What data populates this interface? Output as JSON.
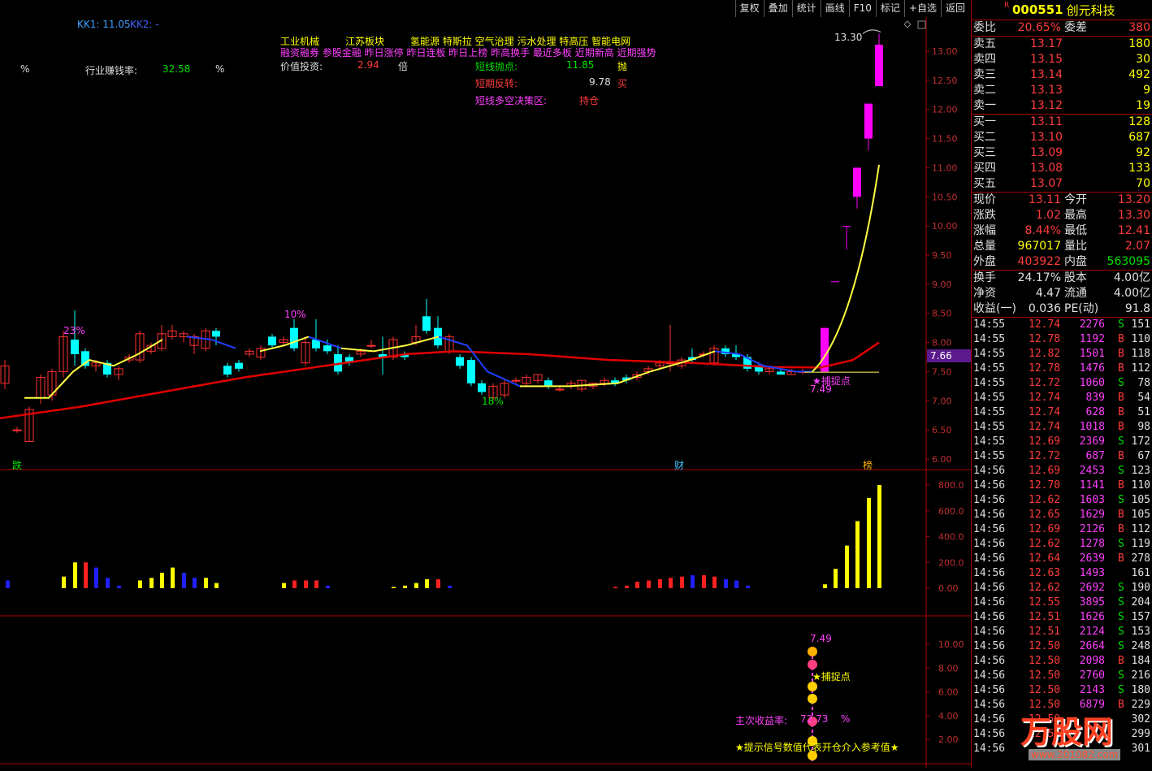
{
  "toolbar": [
    "复权",
    "叠加",
    "统计",
    "画线",
    "F10",
    "标记",
    "+自选",
    "返回"
  ],
  "header_left": {
    "kk1": "KK1: 11.05",
    "kk2": "KK2: -"
  },
  "sectors": {
    "line1_a": "工业机械",
    "line1_b": "江苏板块",
    "line1_c": "氢能源 特斯拉 空气治理 污水处理 特高压 智能电网",
    "line2": "融资融券 参股金融 昨日涨停 昨日连板 昨日上榜 昨高换手 最近多板 近期新高 近期强势"
  },
  "info": {
    "pct": "%",
    "industry_label": "行业赚钱率:",
    "industry_value": "32.58",
    "industry_unit": "%",
    "value_label": "价值投资:",
    "value_value": "2.94",
    "value_unit": "倍",
    "short_sell_label": "短线抛点:",
    "short_sell_value": "11.85",
    "short_sell_tag": "抛",
    "short_rev_label": "短期反转:",
    "short_rev_value": "9.78",
    "short_rev_tag": "买",
    "decision_label": "短线多空决策区:",
    "decision_value": "持仓"
  },
  "price_axis": [
    "13.00",
    "12.50",
    "12.00",
    "11.50",
    "11.00",
    "10.50",
    "10.00",
    "9.50",
    "9.00",
    "8.50",
    "8.00",
    "7.50",
    "7.00",
    "6.50",
    "6.00"
  ],
  "price_marker": "7.66",
  "annotations": {
    "high": "13.30",
    "pct23": "23%",
    "pct10": "10%",
    "pct18": "18%",
    "low": "7.49",
    "capture": "★捕捉点",
    "die": "跌",
    "cai": "财",
    "bang": "榜"
  },
  "vol_axis": [
    "800.0",
    "600.0",
    "400.0",
    "200.0",
    "0.00"
  ],
  "ind_axis": [
    "10.00",
    "8.00",
    "6.00",
    "4.00",
    "2.00"
  ],
  "ind": {
    "top": "7.49",
    "capture": "★捕捉点",
    "profit_label": "主次收益率:",
    "profit_value": "72.73",
    "profit_unit": "%",
    "hint": "★提示信号数值代表开仓介入参考值★"
  },
  "watermark": {
    "name": "万股网",
    "url": "www.201082.com"
  },
  "stock": {
    "flag": "R",
    "code": "000551",
    "name": "创元科技"
  },
  "weibi": {
    "l1": "委比",
    "v1": "20.65%",
    "l2": "委差",
    "v2": "380"
  },
  "asks": [
    {
      "label": "卖五",
      "price": "13.17",
      "vol": "180"
    },
    {
      "label": "卖四",
      "price": "13.15",
      "vol": "30"
    },
    {
      "label": "卖三",
      "price": "13.14",
      "vol": "492"
    },
    {
      "label": "卖二",
      "price": "13.13",
      "vol": "9"
    },
    {
      "label": "卖一",
      "price": "13.12",
      "vol": "19"
    }
  ],
  "bids": [
    {
      "label": "买一",
      "price": "13.11",
      "vol": "128"
    },
    {
      "label": "买二",
      "price": "13.10",
      "vol": "687"
    },
    {
      "label": "买三",
      "price": "13.09",
      "vol": "92"
    },
    {
      "label": "买四",
      "price": "13.08",
      "vol": "133"
    },
    {
      "label": "买五",
      "price": "13.07",
      "vol": "70"
    }
  ],
  "quote": [
    {
      "l1": "现价",
      "v1": "13.11",
      "c1": "red",
      "l2": "今开",
      "v2": "13.20",
      "c2": "red"
    },
    {
      "l1": "涨跌",
      "v1": "1.02",
      "c1": "red",
      "l2": "最高",
      "v2": "13.30",
      "c2": "red"
    },
    {
      "l1": "涨幅",
      "v1": "8.44%",
      "c1": "red",
      "l2": "最低",
      "v2": "12.41",
      "c2": "red"
    },
    {
      "l1": "总量",
      "v1": "967017",
      "c1": "yel",
      "l2": "量比",
      "v2": "2.07",
      "c2": "red"
    },
    {
      "l1": "外盘",
      "v1": "403922",
      "c1": "red",
      "l2": "内盘",
      "v2": "563095",
      "c2": "grn"
    }
  ],
  "fund": [
    {
      "l1": "换手",
      "v1": "24.17%",
      "l2": "股本",
      "v2": "4.00亿"
    },
    {
      "l1": "净资",
      "v1": "4.47",
      "l2": "流通",
      "v2": "4.00亿"
    },
    {
      "l1": "收益(一)",
      "v1": "0.036",
      "l2": "PE(动)",
      "v2": "91.8"
    }
  ],
  "ticks": [
    {
      "t": "14:55",
      "p": "12.74",
      "v": "2276",
      "s": "S",
      "n": "151"
    },
    {
      "t": "14:55",
      "p": "12.78",
      "v": "1192",
      "s": "B",
      "n": "110"
    },
    {
      "t": "14:55",
      "p": "12.82",
      "v": "1501",
      "s": "B",
      "n": "118"
    },
    {
      "t": "14:55",
      "p": "12.78",
      "v": "1476",
      "s": "B",
      "n": "112"
    },
    {
      "t": "14:55",
      "p": "12.72",
      "v": "1060",
      "s": "S",
      "n": "78"
    },
    {
      "t": "14:55",
      "p": "12.74",
      "v": "839",
      "s": "B",
      "n": "54"
    },
    {
      "t": "14:55",
      "p": "12.74",
      "v": "628",
      "s": "B",
      "n": "51"
    },
    {
      "t": "14:55",
      "p": "12.74",
      "v": "1018",
      "s": "B",
      "n": "98"
    },
    {
      "t": "14:55",
      "p": "12.69",
      "v": "2369",
      "s": "S",
      "n": "172"
    },
    {
      "t": "14:55",
      "p": "12.72",
      "v": "687",
      "s": "B",
      "n": "67"
    },
    {
      "t": "14:56",
      "p": "12.69",
      "v": "2453",
      "s": "S",
      "n": "123"
    },
    {
      "t": "14:56",
      "p": "12.70",
      "v": "1141",
      "s": "B",
      "n": "110"
    },
    {
      "t": "14:56",
      "p": "12.62",
      "v": "1603",
      "s": "S",
      "n": "105"
    },
    {
      "t": "14:56",
      "p": "12.65",
      "v": "1629",
      "s": "B",
      "n": "105"
    },
    {
      "t": "14:56",
      "p": "12.69",
      "v": "2126",
      "s": "B",
      "n": "112"
    },
    {
      "t": "14:56",
      "p": "12.62",
      "v": "1278",
      "s": "S",
      "n": "119"
    },
    {
      "t": "14:56",
      "p": "12.64",
      "v": "2639",
      "s": "B",
      "n": "278"
    },
    {
      "t": "14:56",
      "p": "12.63",
      "v": "1493",
      "s": "",
      "n": "161"
    },
    {
      "t": "14:56",
      "p": "12.62",
      "v": "2692",
      "s": "S",
      "n": "190"
    },
    {
      "t": "14:56",
      "p": "12.55",
      "v": "3895",
      "s": "S",
      "n": "204"
    },
    {
      "t": "14:56",
      "p": "12.51",
      "v": "1626",
      "s": "S",
      "n": "157"
    },
    {
      "t": "14:56",
      "p": "12.51",
      "v": "2124",
      "s": "S",
      "n": "153"
    },
    {
      "t": "14:56",
      "p": "12.50",
      "v": "2664",
      "s": "S",
      "n": "248"
    },
    {
      "t": "14:56",
      "p": "12.50",
      "v": "2098",
      "s": "B",
      "n": "184"
    },
    {
      "t": "14:56",
      "p": "12.50",
      "v": "2760",
      "s": "S",
      "n": "216"
    },
    {
      "t": "14:56",
      "p": "12.50",
      "v": "2143",
      "s": "S",
      "n": "180"
    },
    {
      "t": "14:56",
      "p": "12.50",
      "v": "6879",
      "s": "B",
      "n": "229"
    },
    {
      "t": "14:56",
      "p": "12.50",
      "v": "",
      "s": "",
      "n": "302"
    },
    {
      "t": "14:56",
      "p": "12.50",
      "v": "",
      "s": "",
      "n": "299"
    },
    {
      "t": "14:56",
      "p": "",
      "v": "",
      "s": "",
      "n": "301"
    }
  ]
}
